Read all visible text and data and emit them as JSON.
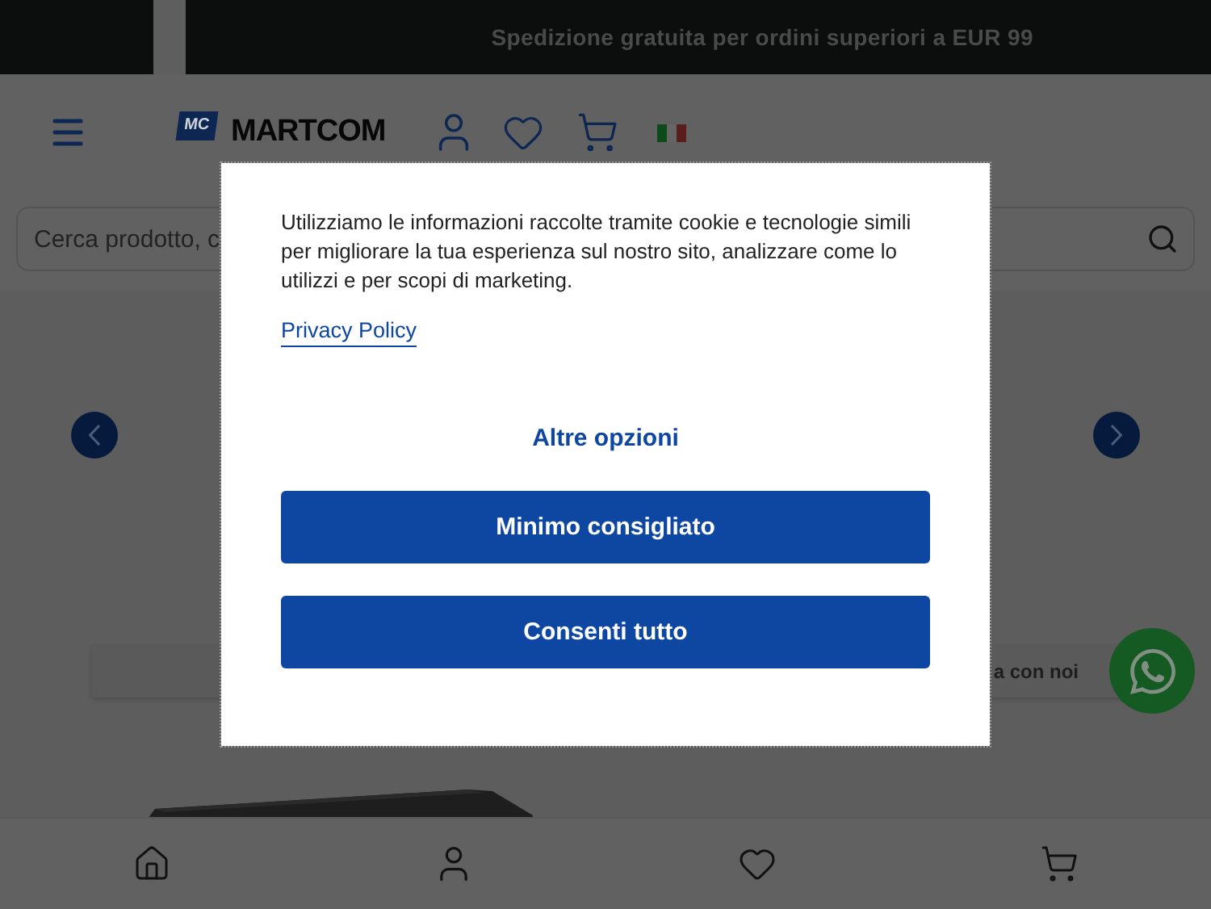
{
  "top_bar": {
    "message": "Spedizione gratuita per ordini superiori a EUR 99"
  },
  "header": {
    "logo_mark": "MC",
    "logo_text": "MARTCOM"
  },
  "search": {
    "placeholder": "Cerca prodotto, c"
  },
  "contact_bar": {
    "label": "a con noi"
  },
  "cookie_dialog": {
    "text": "Utilizziamo le informazioni raccolte tramite cookie e tecnologie simili per migliorare la tua esperienza sul nostro sito, analizzare come lo utilizzi e per scopi di marketing.",
    "link": "Privacy Policy",
    "more_options": "Altre opzioni",
    "buttons": [
      "Minimo consigliato",
      "Consenti tutto"
    ]
  }
}
